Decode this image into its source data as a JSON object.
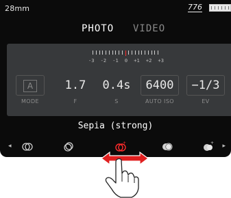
{
  "status": {
    "focal_length": "28mm",
    "shots_remaining": "776"
  },
  "modes": {
    "photo": "PHOTO",
    "video": "VIDEO"
  },
  "scale_labels": [
    "-3",
    "-2",
    "-1",
    "0",
    "+1",
    "+2",
    "+3"
  ],
  "params": [
    {
      "value": "A",
      "label": "MODE"
    },
    {
      "value": "1.7",
      "label": "F"
    },
    {
      "value": "0.4s",
      "label": "S"
    },
    {
      "value": "6400",
      "label": "AUTO ISO"
    },
    {
      "value": "−1/3",
      "label": "EV"
    }
  ],
  "filter": {
    "selected_name": "Sepia (strong)"
  },
  "colors": {
    "background": "#0b0b0b",
    "panel": "#37393b",
    "accent": "#ff2b2b"
  }
}
